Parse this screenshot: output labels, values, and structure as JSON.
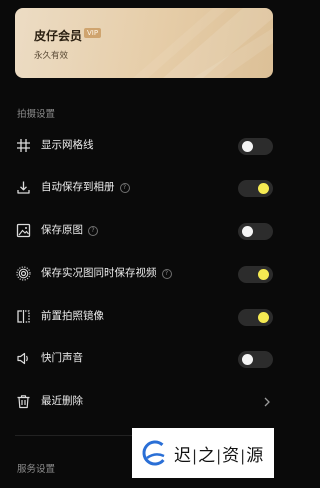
{
  "vip": {
    "title": "皮仔会员",
    "badge": "VIP",
    "subtitle": "永久有效"
  },
  "sections": {
    "shooting": "拍摄设置",
    "service": "服务设置"
  },
  "items": [
    {
      "label": "显示网格线",
      "icon": "grid-icon",
      "control": "toggle",
      "on": false,
      "help": false
    },
    {
      "label": "自动保存到相册",
      "icon": "download-icon",
      "control": "toggle",
      "on": true,
      "help": true
    },
    {
      "label": "保存原图",
      "icon": "image-icon",
      "control": "toggle",
      "on": false,
      "help": true
    },
    {
      "label": "保存实况图同时保存视频",
      "icon": "live-photo-icon",
      "control": "toggle",
      "on": true,
      "help": true
    },
    {
      "label": "前置拍照镜像",
      "icon": "mirror-icon",
      "control": "toggle",
      "on": true,
      "help": false
    },
    {
      "label": "快门声音",
      "icon": "speaker-icon",
      "control": "toggle",
      "on": false,
      "help": false
    },
    {
      "label": "最近删除",
      "icon": "trash-icon",
      "control": "chevron",
      "help": false
    }
  ],
  "help_glyph": "?",
  "watermark": {
    "part1": "迟",
    "part2": "之",
    "part3": "资",
    "part4": "源"
  },
  "colors": {
    "background": "#0a0a0a",
    "toggle_on_knob": "#f5ea52",
    "toggle_track": "#2c2c2c",
    "vip_gold": "#e6cda8"
  }
}
